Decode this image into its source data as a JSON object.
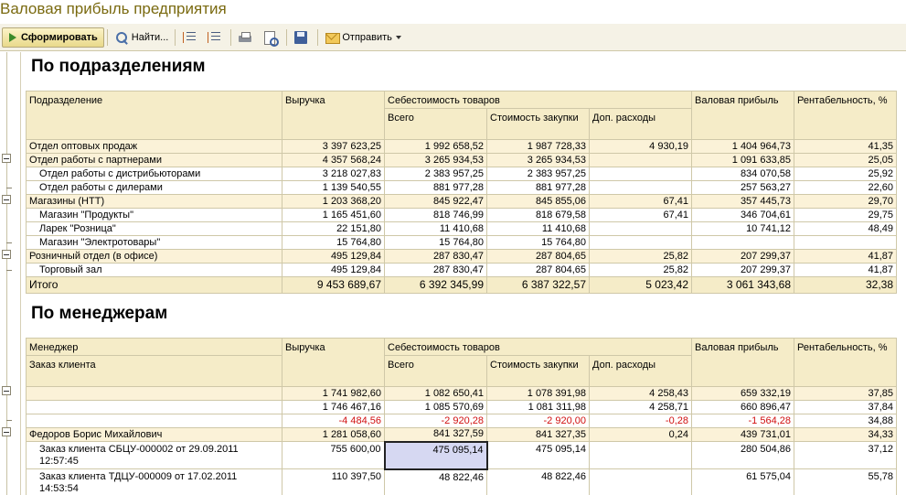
{
  "window": {
    "title": "Валовая прибыль предприятия"
  },
  "toolbar": {
    "generate_label": "Сформировать",
    "find_label": "Найти...",
    "send_label": "Отправить"
  },
  "section1": {
    "title": "По подразделениям",
    "headers": {
      "col1": "Подразделение",
      "revenue": "Выручка",
      "cost_group": "Себестоимость товаров",
      "total": "Всего",
      "purchase_cost": "Стоимость закупки",
      "extra_costs": "Доп. расходы",
      "gross_profit": "Валовая прибыль",
      "profitability": "Рентабельность, %"
    },
    "rows": [
      {
        "name": "Отдел оптовых продаж",
        "revenue": "3 397 623,25",
        "total": "1 992 658,52",
        "purchase": "1 987 728,33",
        "extra": "4 930,19",
        "gross": "1 404 964,73",
        "profit": "41,35"
      },
      {
        "name": "Отдел работы с партнерами",
        "revenue": "4 357 568,24",
        "total": "3 265 934,53",
        "purchase": "3 265 934,53",
        "extra": "",
        "gross": "1 091 633,85",
        "profit": "25,05"
      },
      {
        "name": "Отдел работы с дистрибьюторами",
        "revenue": "3 218 027,83",
        "total": "2 383 957,25",
        "purchase": "2 383 957,25",
        "extra": "",
        "gross": "834 070,58",
        "profit": "25,92"
      },
      {
        "name": "Отдел работы с дилерами",
        "revenue": "1 139 540,55",
        "total": "881 977,28",
        "purchase": "881 977,28",
        "extra": "",
        "gross": "257 563,27",
        "profit": "22,60"
      },
      {
        "name": "Магазины (НТТ)",
        "revenue": "1 203 368,20",
        "total": "845 922,47",
        "purchase": "845 855,06",
        "extra": "67,41",
        "gross": "357 445,73",
        "profit": "29,70"
      },
      {
        "name": "Магазин \"Продукты\"",
        "revenue": "1 165 451,60",
        "total": "818 746,99",
        "purchase": "818 679,58",
        "extra": "67,41",
        "gross": "346 704,61",
        "profit": "29,75"
      },
      {
        "name": "Ларек \"Розница\"",
        "revenue": "22 151,80",
        "total": "11 410,68",
        "purchase": "11 410,68",
        "extra": "",
        "gross": "10 741,12",
        "profit": "48,49"
      },
      {
        "name": "Магазин \"Электротовары\"",
        "revenue": "15 764,80",
        "total": "15 764,80",
        "purchase": "15 764,80",
        "extra": "",
        "gross": "",
        "profit": ""
      },
      {
        "name": "Розничный отдел (в офисе)",
        "revenue": "495 129,84",
        "total": "287 830,47",
        "purchase": "287 804,65",
        "extra": "25,82",
        "gross": "207 299,37",
        "profit": "41,87"
      },
      {
        "name": "Торговый зал",
        "revenue": "495 129,84",
        "total": "287 830,47",
        "purchase": "287 804,65",
        "extra": "25,82",
        "gross": "207 299,37",
        "profit": "41,87"
      }
    ],
    "totals": {
      "name": "Итого",
      "revenue": "9 453 689,67",
      "total": "6 392 345,99",
      "purchase": "6 387 322,57",
      "extra": "5 023,42",
      "gross": "3 061 343,68",
      "profit": "32,38"
    }
  },
  "section2": {
    "title": "По менеджерам",
    "headers": {
      "col1": "Менеджер",
      "col1_sub": "Заказ клиента",
      "revenue": "Выручка",
      "cost_group": "Себестоимость товаров",
      "total": "Всего",
      "purchase_cost": "Стоимость закупки",
      "extra_costs": "Доп. расходы",
      "gross_profit": "Валовая прибыль",
      "profitability": "Рентабельность, %"
    },
    "rows": [
      {
        "name": "",
        "revenue": "1 741 982,60",
        "total": "1 082 650,41",
        "purchase": "1 078 391,98",
        "extra": "4 258,43",
        "gross": "659 332,19",
        "profit": "37,85"
      },
      {
        "name": "",
        "revenue": "1 746 467,16",
        "total": "1 085 570,69",
        "purchase": "1 081 311,98",
        "extra": "4 258,71",
        "gross": "660 896,47",
        "profit": "37,84"
      },
      {
        "name": "",
        "revenue": "-4 484,56",
        "total": "-2 920,28",
        "purchase": "-2 920,00",
        "extra": "-0,28",
        "gross": "-1 564,28",
        "profit": "34,88"
      },
      {
        "name": "Федоров Борис Михайлович",
        "revenue": "1 281 058,60",
        "total": "841 327,59",
        "purchase": "841 327,35",
        "extra": "0,24",
        "gross": "439 731,01",
        "profit": "34,33"
      },
      {
        "name": "Заказ клиента СБЦУ-000002 от 29.09.2011 12:57:45",
        "revenue": "755 600,00",
        "total": "475 095,14",
        "purchase": "475 095,14",
        "extra": "",
        "gross": "280 504,86",
        "profit": "37,12"
      },
      {
        "name": "Заказ клиента ТДЦУ-000009 от 17.02.2011 14:53:54",
        "revenue": "110 397,50",
        "total": "48 822,46",
        "purchase": "48 822,46",
        "extra": "",
        "gross": "61 575,04",
        "profit": "55,78"
      }
    ]
  }
}
